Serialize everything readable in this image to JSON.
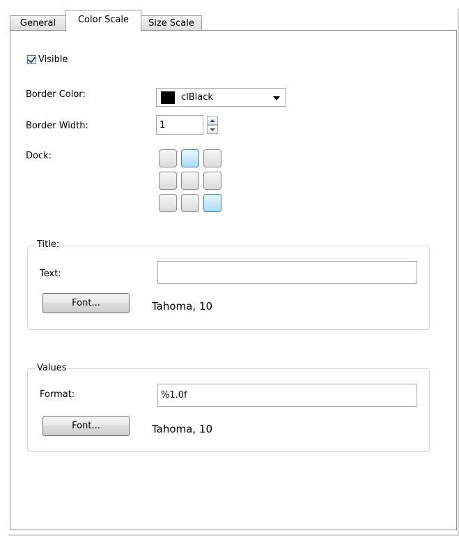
{
  "tabs": [
    {
      "label": "General",
      "active": false
    },
    {
      "label": "Color Scale",
      "active": true
    },
    {
      "label": "Size Scale",
      "active": false
    }
  ],
  "visible": {
    "label": "Visible",
    "checked": true
  },
  "border_color": {
    "label": "Border Color:",
    "value": "clBlack",
    "swatch": "#000000"
  },
  "border_width": {
    "label": "Border Width:",
    "value": "1"
  },
  "dock": {
    "label": "Dock:",
    "selected": [
      [
        0,
        1
      ],
      [
        2,
        2
      ]
    ]
  },
  "title_group": {
    "legend": "Title:",
    "text_label": "Text:",
    "text_value": "",
    "font_button": "Font...",
    "font_value": "Tahoma, 10"
  },
  "values_group": {
    "legend": "Values",
    "format_label": "Format:",
    "format_value": "%1.0f",
    "font_button": "Font...",
    "font_value": "Tahoma, 10"
  },
  "colors": {
    "selected_dock_top": "#eaf6fd",
    "selected_dock_bottom": "#a9dbf6",
    "check": "#2a4a8a"
  },
  "icons": [
    "checkmark-icon",
    "dropdown-arrow-icon",
    "spin-up-icon",
    "spin-down-icon"
  ]
}
